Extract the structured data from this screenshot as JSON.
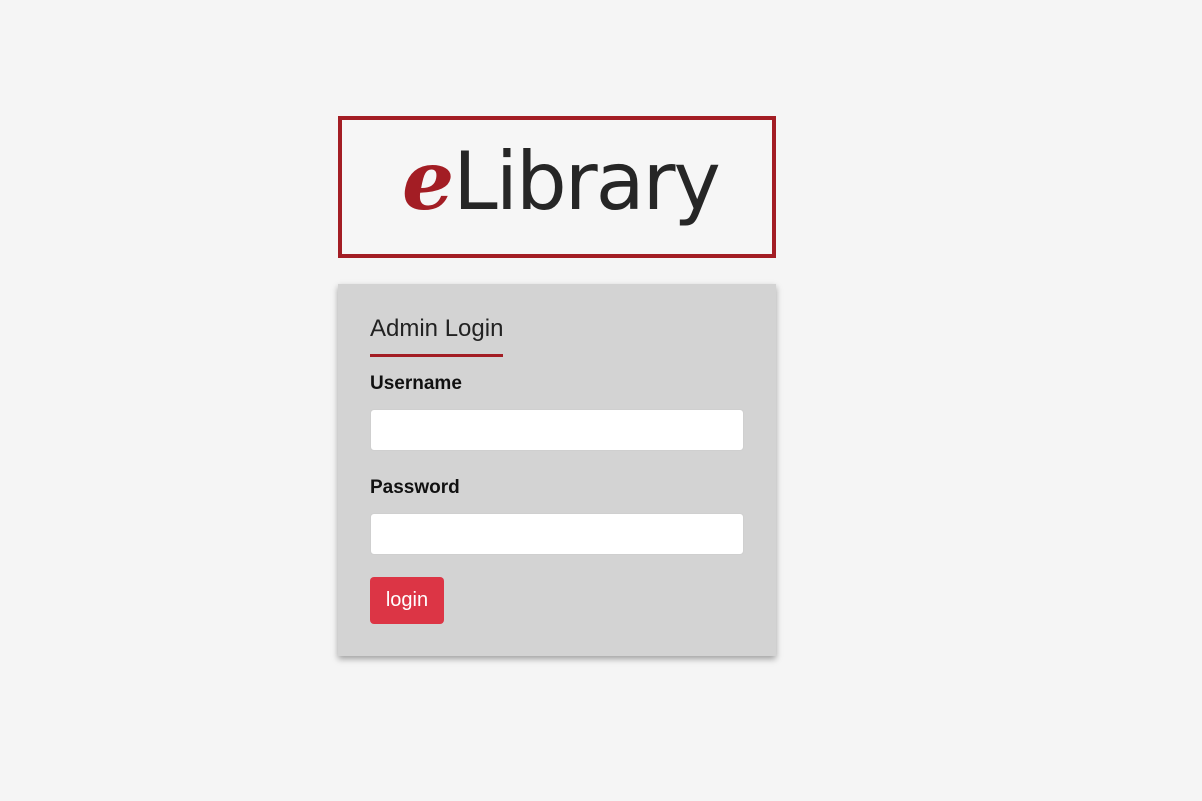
{
  "logo": {
    "prefix": "e",
    "name": "Library",
    "accent_color": "#a31d24"
  },
  "login_form": {
    "title": "Admin Login",
    "username_label": "Username",
    "username_value": "",
    "username_placeholder": "",
    "password_label": "Password",
    "password_value": "",
    "password_placeholder": "",
    "submit_label": "login",
    "submit_color": "#dc3545"
  }
}
